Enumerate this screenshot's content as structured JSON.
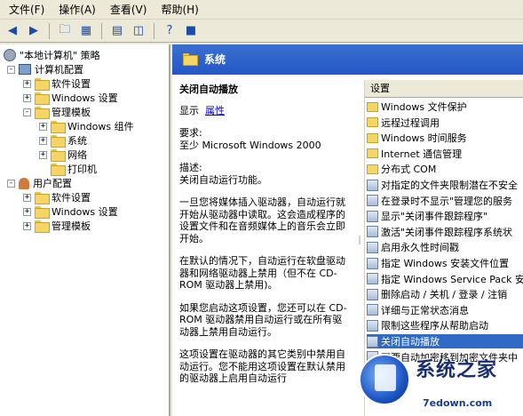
{
  "menubar": {
    "items": [
      "文件(F)",
      "操作(A)",
      "查看(V)",
      "帮助(H)"
    ]
  },
  "toolbar": {
    "buttons": [
      "back-icon",
      "forward-icon",
      "up-folder-icon",
      "show-tree-icon",
      "properties-icon",
      "export-icon",
      "help-icon",
      "view-icon"
    ]
  },
  "tree": {
    "root": "\"本地计算机\" 策略",
    "computer_config": "计算机配置",
    "software_settings": "软件设置",
    "windows_settings": "Windows 设置",
    "admin_templates": "管理模板",
    "windows_components": "Windows 组件",
    "system": "系统",
    "network": "网络",
    "printers": "打印机",
    "user_config": "用户配置",
    "user_software_settings": "软件设置",
    "user_windows_settings": "Windows 设置",
    "user_admin_templates": "管理模板"
  },
  "content": {
    "header_title": "系统",
    "policy_title": "关闭自动播放",
    "display_label": "显示",
    "properties_link": "属性",
    "requirements_label": "要求:",
    "requirements_value": "至少 Microsoft Windows 2000",
    "description_label": "描述:",
    "description_p1": "关闭自动运行功能。",
    "description_p2": "一旦您将媒体插入驱动器，自动运行就开始从驱动器中读取。这会造成程序的设置文件和在音频媒体上的音乐会立即开始。",
    "description_p3": "在默认的情况下，自动运行在软盘驱动器和网络驱动器上禁用（但不在 CD-ROM 驱动器上禁用)。",
    "description_p4": "如果您启动这项设置，您还可以在 CD-ROM 驱动器禁用自动运行或在所有驱动器上禁用自动运行。",
    "description_p5": "这项设置在驱动器的其它类别中禁用自动运行。您不能用这项设置在默认禁用的驱动器上启用自动运行"
  },
  "settings": {
    "header": "设置",
    "rows": [
      {
        "label": "Windows 文件保护",
        "kind": "folder"
      },
      {
        "label": "远程过程调用",
        "kind": "folder"
      },
      {
        "label": "Windows 时间服务",
        "kind": "folder"
      },
      {
        "label": "Internet 通信管理",
        "kind": "folder"
      },
      {
        "label": "分布式 COM",
        "kind": "folder"
      },
      {
        "label": "对指定的文件夹限制潜在不安全",
        "kind": "setting"
      },
      {
        "label": "在登录时不显示\"管理您的服务",
        "kind": "setting"
      },
      {
        "label": "显示\"关闭事件跟踪程序\"",
        "kind": "setting"
      },
      {
        "label": "激活\"关闭事件跟踪程序系统状",
        "kind": "setting"
      },
      {
        "label": "启用永久性时间戳",
        "kind": "setting"
      },
      {
        "label": "指定 Windows 安装文件位置",
        "kind": "setting"
      },
      {
        "label": "指定 Windows Service Pack 安装",
        "kind": "setting"
      },
      {
        "label": "删除启动 / 关机 / 登录 / 注销",
        "kind": "setting"
      },
      {
        "label": "详细与正常状态消息",
        "kind": "setting"
      },
      {
        "label": "限制这些程序从帮助启动",
        "kind": "setting"
      },
      {
        "label": "关闭自动播放",
        "kind": "setting",
        "selected": true
      },
      {
        "label": "不要自动加密移到加密文件夹中",
        "kind": "setting"
      }
    ]
  },
  "watermark": {
    "line1": "系统之家",
    "line2": "7edown.com"
  }
}
